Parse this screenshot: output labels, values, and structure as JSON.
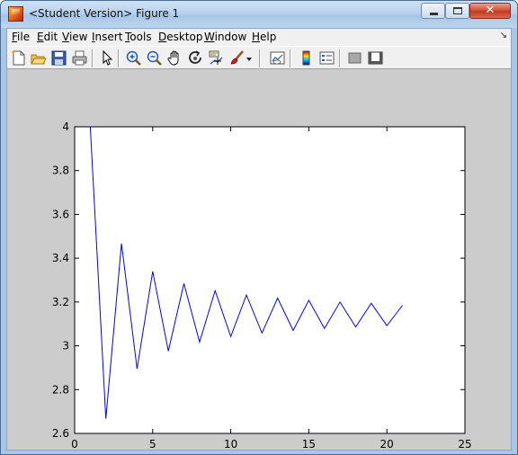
{
  "window": {
    "title": "<Student Version> Figure 1",
    "close_glyph": "✕"
  },
  "menu": {
    "items": [
      {
        "accel": "F",
        "rest": "ile"
      },
      {
        "accel": "E",
        "rest": "dit"
      },
      {
        "accel": "V",
        "rest": "iew"
      },
      {
        "accel": "I",
        "rest": "nsert"
      },
      {
        "accel": "T",
        "rest": "ools"
      },
      {
        "accel": "D",
        "rest": "esktop"
      },
      {
        "accel": "W",
        "rest": "indow"
      },
      {
        "accel": "H",
        "rest": "elp"
      }
    ],
    "dock_glyph": "↘"
  },
  "toolbar": {
    "icons": [
      "new-figure-icon",
      "open-file-icon",
      "save-icon",
      "print-icon",
      "edit-plot-arrow-icon",
      "zoom-in-icon",
      "zoom-out-icon",
      "pan-hand-icon",
      "rotate-3d-icon",
      "data-cursor-icon",
      "brush-icon",
      "brush-dropdown-icon",
      "link-plot-icon",
      "insert-colorbar-icon",
      "insert-legend-icon",
      "hide-plot-tools-icon",
      "show-plot-tools-icon"
    ]
  },
  "chart_data": {
    "type": "line",
    "title": "",
    "xlabel": "",
    "ylabel": "",
    "xlim": [
      0,
      25
    ],
    "ylim": [
      2.6,
      4
    ],
    "xticks": [
      0,
      5,
      10,
      15,
      20,
      25
    ],
    "yticks": [
      2.6,
      2.8,
      3,
      3.2,
      3.4,
      3.6,
      3.8,
      4
    ],
    "xtick_labels": [
      "0",
      "5",
      "10",
      "15",
      "20",
      "25"
    ],
    "ytick_labels": [
      "2.6",
      "2.8",
      "3",
      "3.2",
      "3.4",
      "3.6",
      "3.8",
      "4"
    ],
    "grid": false,
    "legend": "none",
    "series": [
      {
        "color": "#0000ff",
        "x": [
          1,
          2,
          3,
          4,
          5,
          6,
          7,
          8,
          9,
          10,
          11,
          12,
          13,
          14,
          15,
          16,
          17,
          18,
          19,
          20,
          21
        ],
        "y": [
          4.0,
          2.667,
          3.467,
          2.895,
          3.34,
          2.976,
          3.284,
          3.017,
          3.252,
          3.042,
          3.232,
          3.058,
          3.218,
          3.07,
          3.208,
          3.079,
          3.2,
          3.086,
          3.194,
          3.092,
          3.185
        ]
      }
    ]
  }
}
